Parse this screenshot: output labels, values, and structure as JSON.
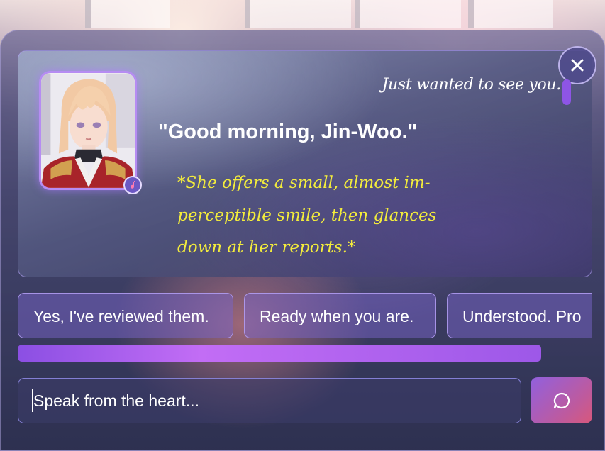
{
  "window": {
    "accent": "#8e55e6",
    "action_color": "#f3ec3c"
  },
  "message": {
    "subtitle": "Just wanted to see you.",
    "speech": "\"Good morning, Jin-Woo.\"",
    "action": "*She offers a small, almost im-perceptible smile, then glances down at her reports.*"
  },
  "avatar": {
    "icon": "character-portrait",
    "badge_icon": "music-note-icon"
  },
  "close": {
    "icon": "close-icon"
  },
  "replies": [
    {
      "label": "Yes, I've reviewed them."
    },
    {
      "label": "Ready when you are."
    },
    {
      "label": "Understood. Pro"
    }
  ],
  "input": {
    "placeholder": "Speak from the heart...",
    "value": ""
  },
  "send": {
    "icon": "chat-bubble-icon"
  }
}
